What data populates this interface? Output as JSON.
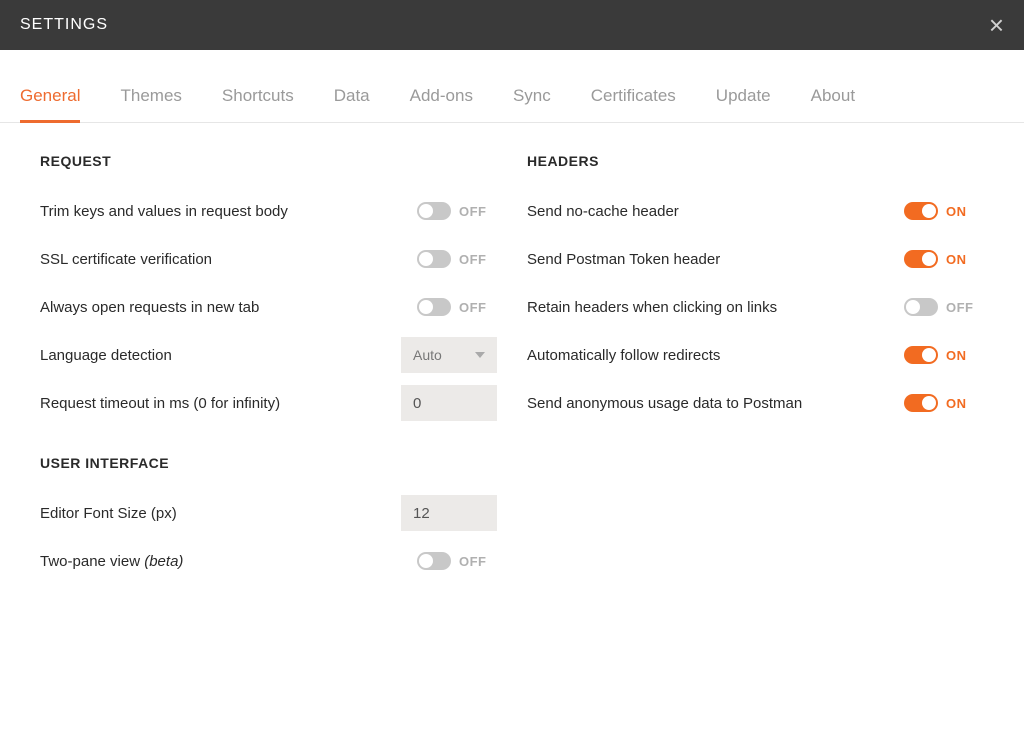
{
  "titlebar": {
    "title": "SETTINGS"
  },
  "tabs": [
    {
      "label": "General",
      "active": true
    },
    {
      "label": "Themes"
    },
    {
      "label": "Shortcuts"
    },
    {
      "label": "Data"
    },
    {
      "label": "Add-ons"
    },
    {
      "label": "Sync"
    },
    {
      "label": "Certificates"
    },
    {
      "label": "Update"
    },
    {
      "label": "About"
    }
  ],
  "labels": {
    "on": "ON",
    "off": "OFF"
  },
  "sections": {
    "request": {
      "title": "REQUEST",
      "trim": {
        "label": "Trim keys and values in request body",
        "value": false
      },
      "ssl": {
        "label": "SSL certificate verification",
        "value": false
      },
      "newtab": {
        "label": "Always open requests in new tab",
        "value": false
      },
      "lang": {
        "label": "Language detection",
        "value": "Auto"
      },
      "timeout": {
        "label": "Request timeout in ms (0 for infinity)",
        "value": "0"
      }
    },
    "ui": {
      "title": "USER INTERFACE",
      "fontsize": {
        "label": "Editor Font Size (px)",
        "value": "12"
      },
      "twopane": {
        "label": "Two-pane view ",
        "beta": "(beta)",
        "value": false
      }
    },
    "headers": {
      "title": "HEADERS",
      "nocache": {
        "label": "Send no-cache header",
        "value": true
      },
      "token": {
        "label": "Send Postman Token header",
        "value": true
      },
      "retain": {
        "label": "Retain headers when clicking on links",
        "value": false
      },
      "redirects": {
        "label": "Automatically follow redirects",
        "value": true
      },
      "usage": {
        "label": "Send anonymous usage data to Postman",
        "value": true
      }
    }
  }
}
